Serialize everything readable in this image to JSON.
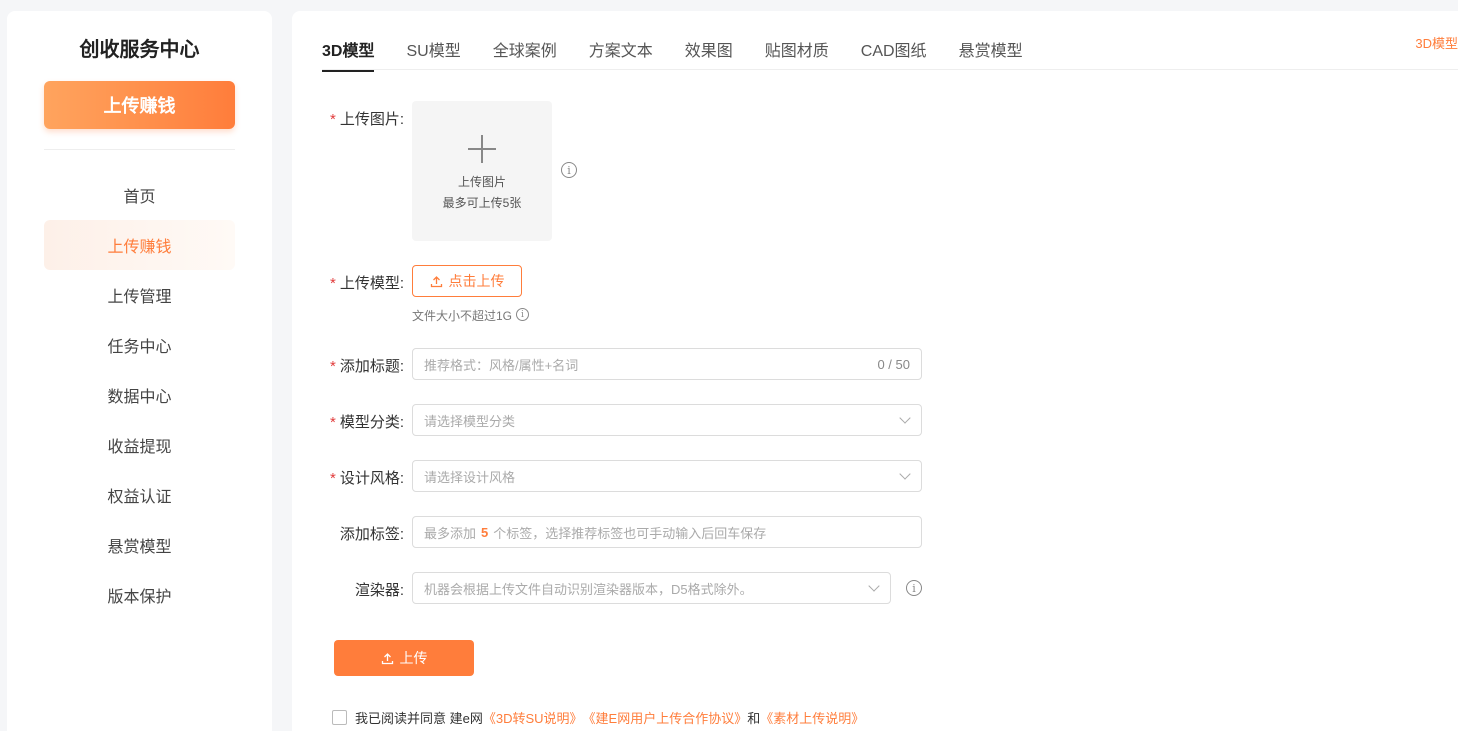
{
  "sidebar": {
    "title": "创收服务中心",
    "cta_label": "上传赚钱",
    "items": [
      {
        "label": "首页"
      },
      {
        "label": "上传赚钱"
      },
      {
        "label": "上传管理"
      },
      {
        "label": "任务中心"
      },
      {
        "label": "数据中心"
      },
      {
        "label": "收益提现"
      },
      {
        "label": "权益认证"
      },
      {
        "label": "悬赏模型"
      },
      {
        "label": "版本保护"
      }
    ],
    "active_index": 1
  },
  "tabs": [
    {
      "label": "3D模型"
    },
    {
      "label": "SU模型"
    },
    {
      "label": "全球案例"
    },
    {
      "label": "方案文本"
    },
    {
      "label": "效果图"
    },
    {
      "label": "贴图材质"
    },
    {
      "label": "CAD图纸"
    },
    {
      "label": "悬赏模型"
    }
  ],
  "active_tab": 0,
  "top_right_text": "3D模型",
  "form": {
    "image": {
      "label": "上传图片:",
      "box_title": "上传图片",
      "box_limit": "最多可上传5张"
    },
    "model": {
      "label": "上传模型:",
      "button_label": "点击上传",
      "hint": "文件大小不超过1G"
    },
    "title": {
      "label": "添加标题:",
      "placeholder": "推荐格式：风格/属性+名词",
      "counter": "0 / 50"
    },
    "category": {
      "label": "模型分类:",
      "placeholder": "请选择模型分类"
    },
    "style": {
      "label": "设计风格:",
      "placeholder": "请选择设计风格"
    },
    "tags": {
      "label": "添加标签:",
      "placeholder_prefix": "最多添加",
      "placeholder_number": "5",
      "placeholder_suffix": "个标签，选择推荐标签也可手动输入后回车保存"
    },
    "renderer": {
      "label": "渲染器:",
      "placeholder": "机器会根据上传文件自动识别渲染器版本，D5格式除外。"
    },
    "submit_label": "上传"
  },
  "agreement": {
    "prefix": "我已阅读并同意 建e网",
    "link1": "《3D转SU说明》",
    "link2": "《建E网用户上传合作协议》",
    "conjunction": "和",
    "link3": "《素材上传说明》"
  },
  "colors": {
    "accent": "#ff7d3b",
    "required": "#e23c3c"
  }
}
